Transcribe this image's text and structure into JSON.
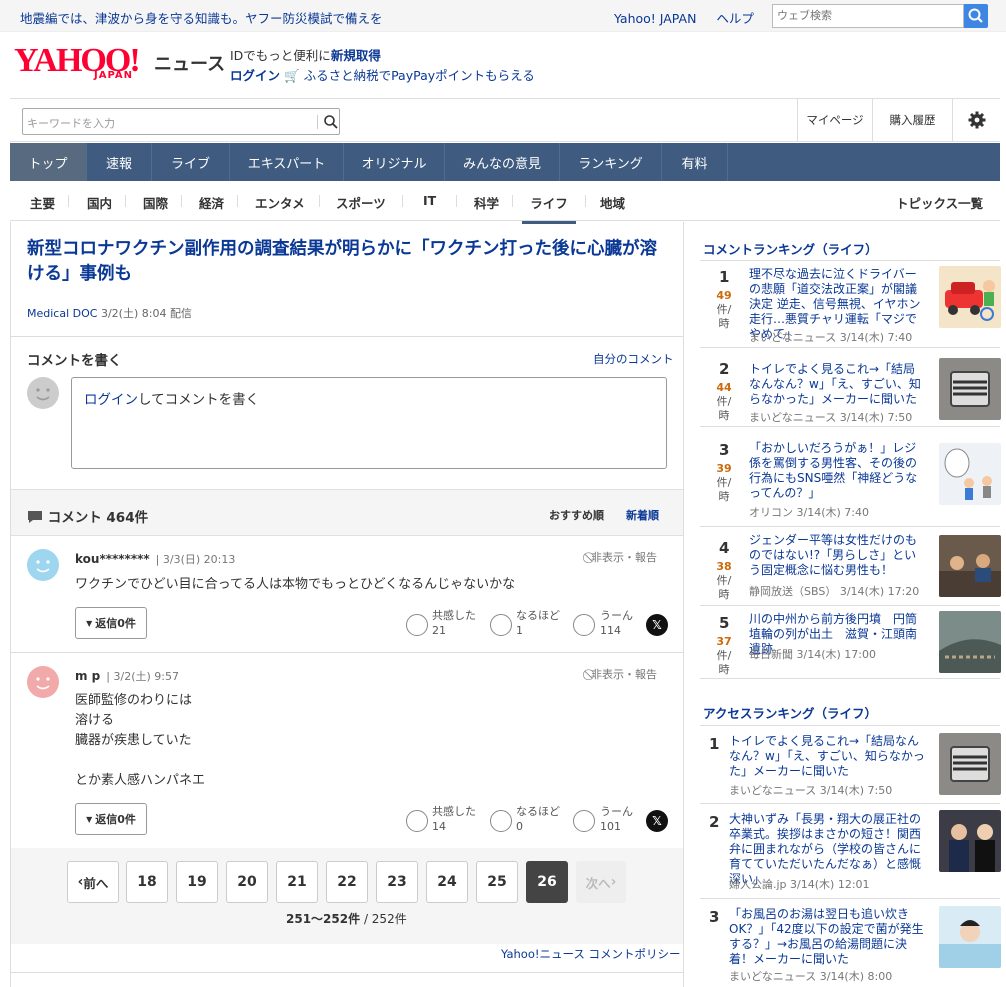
{
  "topbar": {
    "message": "地震編では、津波から身を守る知識も。ヤフー防災模試で備えを",
    "link_yahoo": "Yahoo! JAPAN",
    "link_help": "ヘルプ",
    "search_placeholder": "ウェブ検索"
  },
  "brand": {
    "logo": "YAHOO!",
    "logo_sub": "JAPAN",
    "section": "ニュース",
    "id_prompt": "IDでもっと便利に",
    "id_signup": "新規取得",
    "login": "ログイン",
    "promo": "ふるさと納税でPayPayポイントもらえる"
  },
  "header": {
    "keyword_placeholder": "キーワードを入力",
    "mypage": "マイページ",
    "history": "購入履歴"
  },
  "mainnav": [
    {
      "label": "トップ",
      "active": true
    },
    {
      "label": "速報"
    },
    {
      "label": "ライブ"
    },
    {
      "label": "エキスパート"
    },
    {
      "label": "オリジナル"
    },
    {
      "label": "みんなの意見"
    },
    {
      "label": "ランキング"
    },
    {
      "label": "有料"
    }
  ],
  "subnav": [
    "主要",
    "国内",
    "国際",
    "経済",
    "エンタメ",
    "スポーツ",
    "IT",
    "科学",
    "ライフ",
    "地域"
  ],
  "subnav_active": "ライフ",
  "subnav_right": "トピックス一覧",
  "article": {
    "title": "新型コロナワクチン副作用の調査結果が明らかに「ワクチン打った後に心臓が溶ける」事例も",
    "source": "Medical DOC",
    "date": "3/2(土) 8:04",
    "distributed": "配信"
  },
  "comment_form": {
    "title": "コメントを書く",
    "my_comments": "自分のコメント",
    "login_link": "ログイン",
    "prompt": "してコメントを書く"
  },
  "comments_header": {
    "label": "コメント",
    "count": "464件",
    "sort_recommended": "おすすめ順",
    "sort_newest": "新着順"
  },
  "comments": [
    {
      "user": "kou********",
      "date": "3/3(日) 20:13",
      "hide_report": "非表示・報告",
      "text": "ワクチンでひどい目に合ってる人は本物でもっとひどくなるんじゃないかな",
      "reply": "返信0件",
      "empathy_label": "共感した",
      "empathy": "21",
      "agree_label": "なるほど",
      "agree": "1",
      "hmm_label": "うーん",
      "hmm": "114",
      "avatar_color": "#9fd6ef"
    },
    {
      "user": "m p",
      "date": "3/2(土) 9:57",
      "hide_report": "非表示・報告",
      "text": "医師監修のわりには\n溶ける\n臓器が疾患していた\n\nとか素人感ハンパネエ",
      "reply": "返信0件",
      "empathy_label": "共感した",
      "empathy": "14",
      "agree_label": "なるほど",
      "agree": "0",
      "hmm_label": "うーん",
      "hmm": "101",
      "avatar_color": "#f2a9a9"
    }
  ],
  "pager": {
    "prev": "前へ",
    "pages": [
      "18",
      "19",
      "20",
      "21",
      "22",
      "23",
      "24",
      "25",
      "26"
    ],
    "current": "26",
    "next": "次へ",
    "range": "251〜252件",
    "total": "/ 252件"
  },
  "policy": "Yahoo!ニュース コメントポリシー",
  "comment_ranking": {
    "title": "コメントランキング（ライフ）",
    "unit": "件/時",
    "items": [
      {
        "rank": "1",
        "count": "49",
        "title": "理不尽な過去に泣くドライバーの悲願「道交法改正案」が閣議決定 逆走、信号無視、イヤホン走行…悪質チャリ運転「マジでやめて」",
        "source": "まいどなニュース",
        "date": "3/14(木) 7:40",
        "thumb_color": "#f4e4c8"
      },
      {
        "rank": "2",
        "count": "44",
        "title": "トイレでよく見るこれ→「結局なんなん？w」「え、すごい、知らなかった」メーカーに聞いた",
        "source": "まいどなニュース",
        "date": "3/14(木) 7:50",
        "thumb_color": "#8c8a86"
      },
      {
        "rank": "3",
        "count": "39",
        "title": "「おかしいだろうがぁ！」レジ係を罵倒する男性客、その後の行為にもSNS唖然「神経どうなってんの？」",
        "source": "オリコン",
        "date": "3/14(木) 7:40",
        "thumb_color": "#eef1f6"
      },
      {
        "rank": "4",
        "count": "38",
        "title": "ジェンダー平等は女性だけのものではない!?「男らしさ」という固定概念に悩む男性も！",
        "source": "静岡放送（SBS）",
        "date": "3/14(木) 17:20",
        "thumb_color": "#6a5a4c"
      },
      {
        "rank": "5",
        "count": "37",
        "title": "川の中州から前方後円墳　円筒埴輪の列が出土　滋賀・江頭南遺跡",
        "source": "毎日新聞",
        "date": "3/14(木) 17:00",
        "thumb_color": "#5e6e6a"
      }
    ]
  },
  "access_ranking": {
    "title": "アクセスランキング（ライフ）",
    "items": [
      {
        "rank": "1",
        "title": "トイレでよく見るこれ→「結局なんなん？w」「え、すごい、知らなかった」メーカーに聞いた",
        "source": "まいどなニュース",
        "date": "3/14(木) 7:50",
        "thumb_color": "#8c8a86"
      },
      {
        "rank": "2",
        "title": "大神いずみ「長男・翔大の展正社の卒業式。挨拶はまさかの短さ！関西弁に囲まれながら（学校の皆さんに育てていただいたんだなぁ）と感慨深い」",
        "source": "婦人公論.jp",
        "date": "3/14(木) 12:01",
        "thumb_color": "#3b3c45"
      },
      {
        "rank": "3",
        "title": "「お風呂のお湯は翌日も追い炊きOK？」「42度以下の設定で菌が発生する？」→お風呂の給湯問題に決着！メーカーに聞いた",
        "source": "まいどなニュース",
        "date": "3/14(木) 8:00",
        "thumb_color": "#d9ecf5"
      }
    ]
  },
  "colors": {
    "link": "#0a3895",
    "nav_bg": "#3f5c80",
    "brand_red": "#ff0033",
    "count_orange": "#cd6a0a"
  }
}
